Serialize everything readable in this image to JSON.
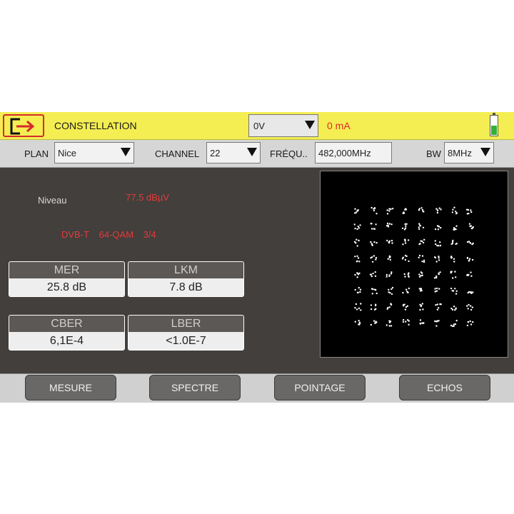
{
  "header": {
    "title": "CONSTELLATION",
    "voltage": "0V",
    "current": "0 mA",
    "battery_level": 0.5,
    "colors": {
      "bar": "#f4ee52",
      "accent": "#e02a2a",
      "battery": "#35b035"
    }
  },
  "settings": {
    "plan_label": "PLAN",
    "plan_value": "Nice",
    "channel_label": "CHANNEL",
    "channel_value": "22",
    "freq_label": "FRÉQU..",
    "freq_value": "482,000MHz",
    "bw_label": "BW",
    "bw_value": "8MHz"
  },
  "signal": {
    "level_label": "Niveau",
    "level_value": "77.5 dBµV",
    "standard": "DVB-T",
    "modulation": "64-QAM",
    "code_rate": "3/4"
  },
  "measurements": {
    "mer": {
      "label": "MER",
      "value": "25.8 dB"
    },
    "lkm": {
      "label": "LKM",
      "value": "7.8 dB"
    },
    "cber": {
      "label": "CBER",
      "value": "6,1E-4"
    },
    "lber": {
      "label": "LBER",
      "value": "<1.0E-7"
    }
  },
  "constellation": {
    "type": "64-QAM",
    "grid": 8
  },
  "nav": {
    "mesure": "MESURE",
    "spectre": "SPECTRE",
    "pointage": "POINTAGE",
    "echos": "ECHOS"
  }
}
